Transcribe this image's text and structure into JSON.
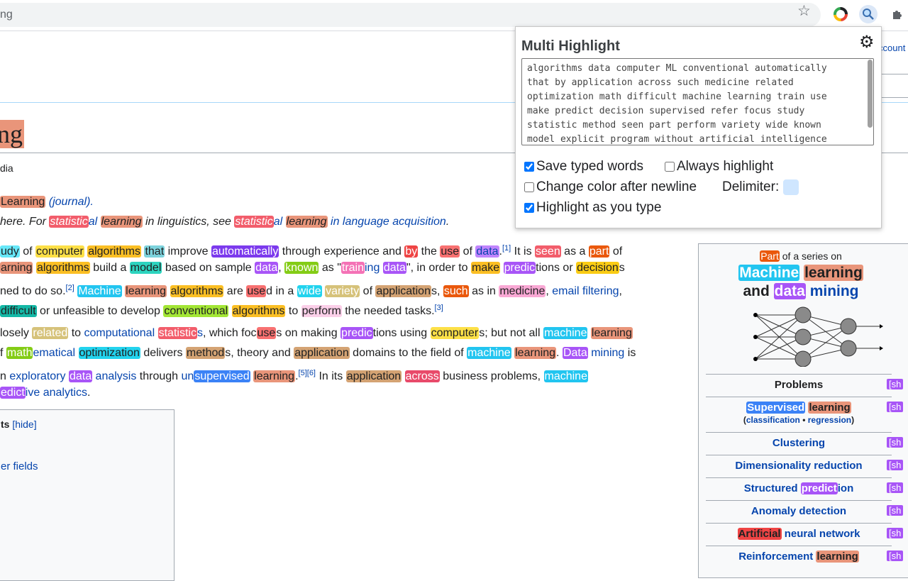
{
  "browser": {
    "url_fragment": "ng",
    "star_icon": "star-icon",
    "extensions": [
      "color-wheel-extension-icon",
      "search-extension-icon",
      "puzzle-extension-icon"
    ]
  },
  "wiki": {
    "account_link": "ccount",
    "title": "ng",
    "from": "dia",
    "hatnote1": {
      "a": "Learning",
      "b": "(journal)."
    },
    "hatnote2": {
      "pre": " here. For ",
      "w1": "statistic",
      "w1b": "al ",
      "w2": "learning",
      "mid": " in linguistics, see ",
      "w3": "statistic",
      "w3b": "al ",
      "w4": "learning",
      "link": " in language acquisition",
      "end": "."
    },
    "toc": {
      "title": "ts",
      "hide": "[hide]",
      "item": "er fields"
    }
  },
  "sidebar": {
    "part_word": "Part",
    "series_text": " of a series on",
    "title_w1": "Machine",
    "title_w2": "learning",
    "title_w3": "and",
    "title_w4": "data",
    "title_w5": "mining",
    "rows": {
      "problems": "Problems",
      "supervised": "Supervised",
      "supervised_b": "learning",
      "sub_open": "(",
      "classification": "classification",
      "dot": " • ",
      "regression": "regression",
      "sub_close": ")",
      "clustering": "Clustering",
      "dimred": "Dimensionality reduction",
      "structured": "Structured ",
      "structured_hl": "predict",
      "structured_end": "ion",
      "anomaly": "Anomaly detection",
      "ann_hl": "Artificial",
      "ann": " neural network",
      "rl": "Reinforcement ",
      "rl_hl": "learning"
    },
    "show_label": "[sh"
  },
  "popup": {
    "title": "Multi Highlight",
    "gear_icon": "gear-icon",
    "words": "algorithms data computer ML conventional automatically\nthat by application across such medicine related\noptimization math difficult machine learning train use\nmake predict decision supervised refer focus study\nstatistic method seen part perform variety wide known\nmodel explicit program without artificial intelligence",
    "save_typed": "Save typed words",
    "always_highlight": "Always highlight",
    "change_color": "Change color after newline",
    "delimiter": "Delimiter:",
    "highlight_as_type": "Highlight as you type",
    "save_typed_checked": true,
    "always_highlight_checked": false,
    "change_color_checked": false,
    "highlight_as_type_checked": true,
    "delimiter_color": "#cfe6ff"
  },
  "colors": {
    "link": "#0645ad",
    "learning": "#e9957a",
    "algorithms": "#fbbf24",
    "computer": "#fde047",
    "study": "#67e8f9",
    "statistic": "#f25d6b",
    "data": "#c084fc",
    "machine": "#22c5f0"
  }
}
